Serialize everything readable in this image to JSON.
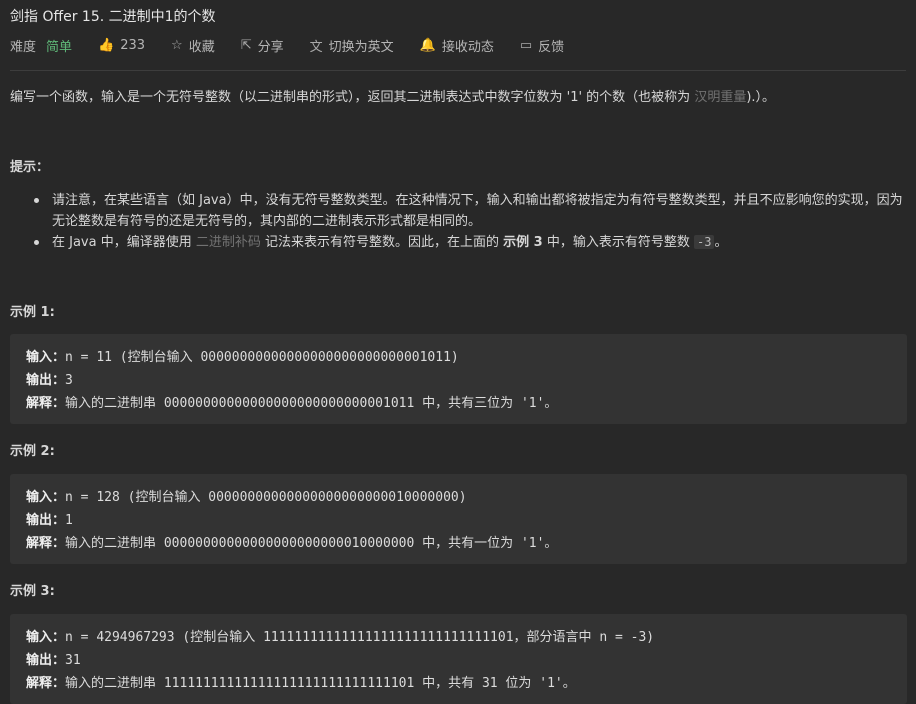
{
  "header": {
    "title": "剑指 Offer 15. 二进制中1的个数"
  },
  "meta": {
    "difficulty_label": "难度",
    "difficulty": "简单",
    "likes": "233",
    "favorite": "收藏",
    "share": "分享",
    "switch_lang": "切换为英文",
    "notify": "接收动态",
    "feedback": "反馈"
  },
  "description": {
    "text": "编写一个函数，输入是一个无符号整数（以二进制串的形式），返回其二进制表达式中数字位数为 '1' 的个数（也被称为 ",
    "link": "汉明重量",
    "suffix": ").）。"
  },
  "hints": {
    "title": "提示：",
    "item1": "请注意，在某些语言（如 Java）中，没有无符号整数类型。在这种情况下，输入和输出都将被指定为有符号整数类型，并且不应影响您的实现，因为无论整数是有符号的还是无符号的，其内部的二进制表示形式都是相同的。",
    "item2_a": "在 Java 中，编译器使用 ",
    "item2_link": "二进制补码",
    "item2_b": " 记法来表示有符号整数。因此，在上面的 ",
    "item2_bold": "示例 3",
    "item2_c": " 中，输入表示有符号整数 ",
    "item2_code": "-3",
    "item2_d": "。"
  },
  "examples": [
    {
      "title": "示例 1:",
      "input_label": "输入：",
      "input": "n = 11 (控制台输入 00000000000000000000000000001011)",
      "output_label": "输出：",
      "output": "3",
      "explain_label": "解释：",
      "explain": "输入的二进制串 00000000000000000000000000001011 中，共有三位为 '1'。"
    },
    {
      "title": "示例 2:",
      "input_label": "输入：",
      "input": "n = 128 (控制台输入 00000000000000000000000010000000)",
      "output_label": "输出：",
      "output": "1",
      "explain_label": "解释：",
      "explain": "输入的二进制串 00000000000000000000000010000000 中，共有一位为 '1'。"
    },
    {
      "title": "示例 3:",
      "input_label": "输入：",
      "input": "n = 4294967293 (控制台输入 11111111111111111111111111111101，部分语言中 n = -3)",
      "output_label": "输出：",
      "output": "31",
      "explain_label": "解释：",
      "explain": "输入的二进制串 11111111111111111111111111111101 中，共有 31 位为 '1'。"
    }
  ]
}
